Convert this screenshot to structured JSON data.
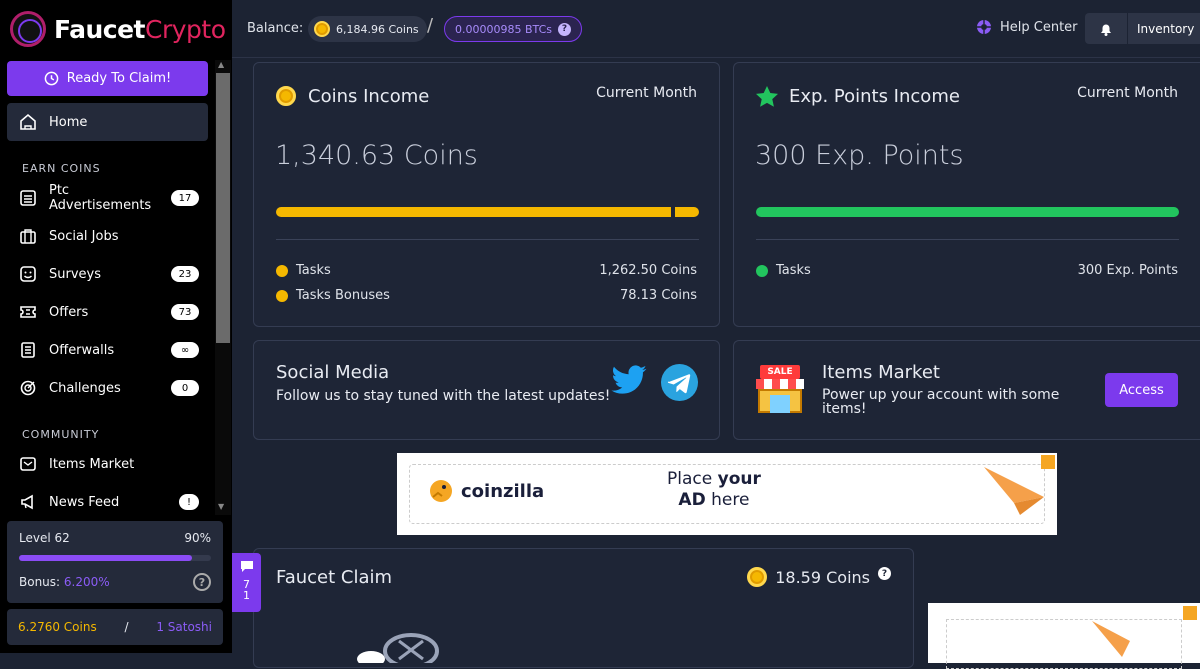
{
  "app": {
    "logo_main": "Faucet",
    "logo_accent": "Crypto"
  },
  "sidebar": {
    "ready_button": "Ready To Claim!",
    "home": "Home",
    "earn_label": "EARN COINS",
    "earn_items": [
      {
        "label": "Ptc Advertisements",
        "badge": "17",
        "icon": "list-icon"
      },
      {
        "label": "Social Jobs",
        "badge": "",
        "icon": "briefcase-icon"
      },
      {
        "label": "Surveys",
        "badge": "23",
        "icon": "smile-icon"
      },
      {
        "label": "Offers",
        "badge": "73",
        "icon": "ticket-icon"
      },
      {
        "label": "Offerwalls",
        "badge": "∞",
        "icon": "wall-icon"
      },
      {
        "label": "Challenges",
        "badge": "0",
        "icon": "target-icon"
      }
    ],
    "community_label": "COMMUNITY",
    "community_items": [
      {
        "label": "Items Market",
        "badge": "",
        "icon": "market-icon"
      },
      {
        "label": "News Feed",
        "badge": "!",
        "icon": "megaphone-icon"
      }
    ],
    "level": {
      "label": "Level 62",
      "percent_text": "90%",
      "progress": 0.9,
      "bonus_label": "Bonus:",
      "bonus_value": "6.200%"
    },
    "wallet": {
      "coins": "6.2760 Coins",
      "sep": "/",
      "satoshi": "1 Satoshi"
    }
  },
  "topbar": {
    "balance_label": "Balance:",
    "coins": "6,184.96 Coins",
    "slash": "/",
    "btc": "0.00000985 BTCs",
    "help_center": "Help Center",
    "inventory": "Inventory"
  },
  "coins_income": {
    "title": "Coins Income",
    "period": "Current Month",
    "total": "1,340.63 Coins",
    "segments": [
      0.942,
      0.058
    ],
    "items": [
      {
        "label": "Tasks",
        "value": "1,262.50 Coins"
      },
      {
        "label": "Tasks Bonuses",
        "value": "78.13 Coins"
      }
    ]
  },
  "exp_income": {
    "title": "Exp. Points Income",
    "period": "Current Month",
    "total": "300 Exp. Points",
    "items": [
      {
        "label": "Tasks",
        "value": "300 Exp. Points"
      }
    ]
  },
  "social": {
    "title": "Social Media",
    "subtitle": "Follow us to stay tuned with the latest updates!"
  },
  "market": {
    "title": "Items Market",
    "subtitle": "Power up your account with some items!",
    "button": "Access",
    "sale": "SALE"
  },
  "ad": {
    "brand": "coinzilla",
    "line1_a": "Place ",
    "line1_b": "your",
    "line2_a": "AD",
    "line2_b": " here"
  },
  "faucet": {
    "title": "Faucet Claim",
    "reward": "18.59 Coins"
  },
  "chat": {
    "count_a": "7",
    "count_b": "1"
  },
  "colors": {
    "accent": "#7c3aed",
    "coin": "#f5b800",
    "exp": "#22c55e"
  }
}
